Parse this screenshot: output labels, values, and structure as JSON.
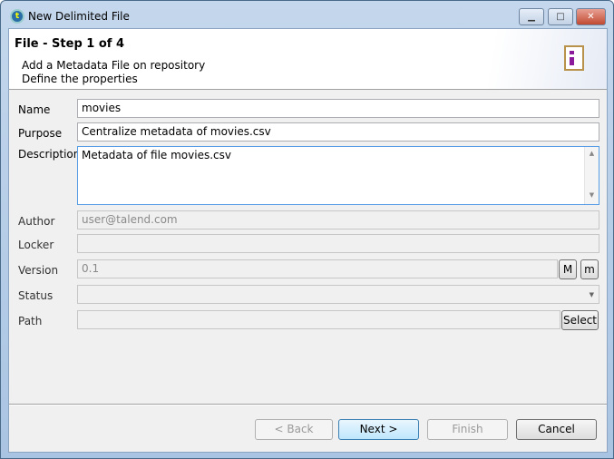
{
  "window": {
    "title": "New Delimited File",
    "app_icon": "talend-icon",
    "controls": {
      "minimize": "minimize-icon",
      "maximize": "maximize-icon",
      "close": "close-icon"
    }
  },
  "header": {
    "title": "File - Step 1 of 4",
    "subtitle1": "Add a Metadata File on repository",
    "subtitle2": "Define the properties",
    "icon": "delimited-file-icon"
  },
  "form": {
    "name": {
      "label": "Name",
      "value": "movies"
    },
    "purpose": {
      "label": "Purpose",
      "value": "Centralize metadata of movies.csv"
    },
    "description": {
      "label": "Description",
      "value": "Metadata of file movies.csv"
    },
    "author": {
      "label": "Author",
      "value": "user@talend.com"
    },
    "locker": {
      "label": "Locker",
      "value": ""
    },
    "version": {
      "label": "Version",
      "value": "0.1",
      "major_label": "M",
      "minor_label": "m"
    },
    "status": {
      "label": "Status",
      "value": ""
    },
    "path": {
      "label": "Path",
      "value": "",
      "select_label": "Select"
    }
  },
  "footer": {
    "back": "< Back",
    "next": "Next >",
    "finish": "Finish",
    "cancel": "Cancel"
  }
}
